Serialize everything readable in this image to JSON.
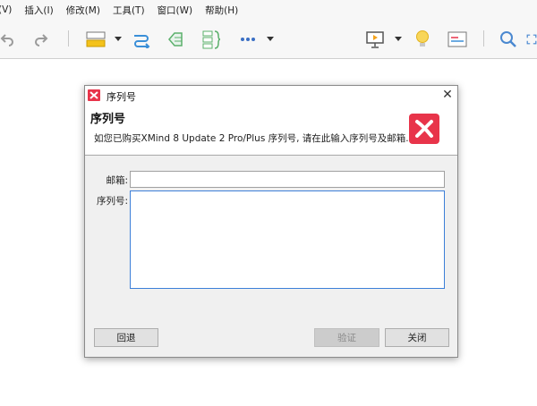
{
  "menubar": {
    "items": [
      "(V)",
      "插入(I)",
      "修改(M)",
      "工具(T)",
      "窗口(W)",
      "帮助(H)"
    ]
  },
  "toolbar": {
    "icons": [
      "undo-icon",
      "redo-icon",
      "topic-style-icon",
      "relationship-icon",
      "boundary-icon",
      "summary-icon",
      "more-icon",
      "presentation-icon",
      "idea-icon",
      "notes-icon",
      "search-icon",
      "fullscreen-icon"
    ]
  },
  "dialog": {
    "title": "序列号",
    "close_glyph": "✕",
    "header_title": "序列号",
    "header_desc": "如您已购买XMind 8 Update 2 Pro/Plus 序列号, 请在此输入序列号及邮箱.",
    "email_label": "邮箱:",
    "email_value": "",
    "serial_label": "序列号:",
    "serial_value": "",
    "back_button": "回退",
    "verify_button": "验证",
    "close_button": "关闭"
  },
  "colors": {
    "accent": "#e8344a",
    "toolbar_yellow": "#f4c21b",
    "toolbar_blue": "#3a8fd8",
    "toolbar_green": "#5bb06b",
    "focus_border": "#3c7fd8"
  }
}
